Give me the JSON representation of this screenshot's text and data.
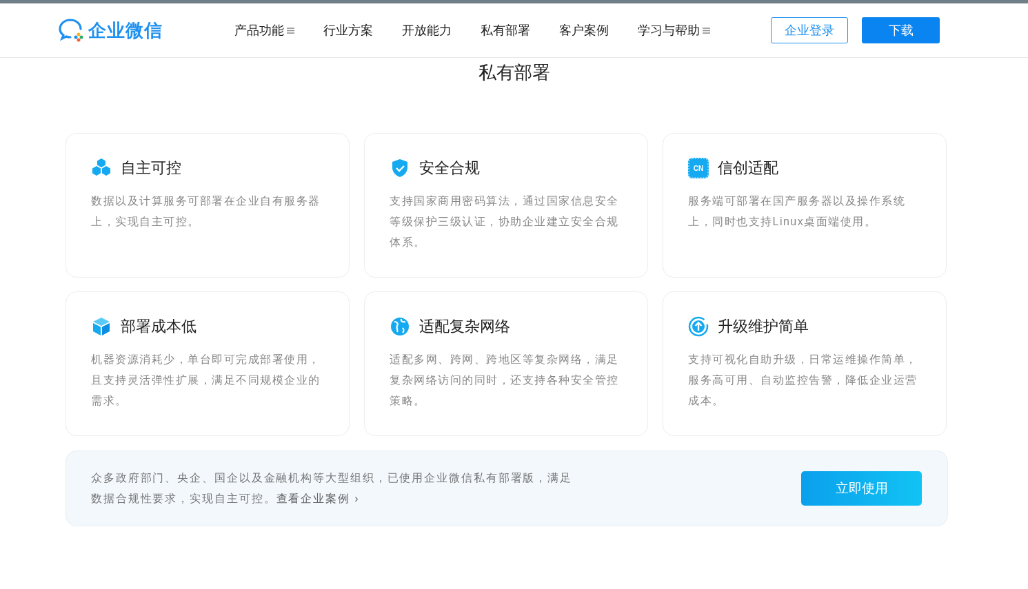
{
  "header": {
    "logo": "企业微信",
    "nav": [
      {
        "label": "产品功能",
        "has_menu": true
      },
      {
        "label": "行业方案",
        "has_menu": false
      },
      {
        "label": "开放能力",
        "has_menu": false
      },
      {
        "label": "私有部署",
        "has_menu": false
      },
      {
        "label": "客户案例",
        "has_menu": false
      },
      {
        "label": "学习与帮助",
        "has_menu": true
      }
    ],
    "login_button": "企业登录",
    "download_button": "下载"
  },
  "section_title": "私有部署",
  "cards": [
    {
      "kind": "hexagons",
      "title": "自主可控",
      "text": "数据以及计算服务可部署在企业自有服务器上，实现自主可控。"
    },
    {
      "kind": "shield",
      "title": "安全合规",
      "text": "支持国家商用密码算法，通过国家信息安全等级保护三级认证，协助企业建立安全合规体系。"
    },
    {
      "kind": "chip",
      "icon_text": "CN",
      "title": "信创适配",
      "text": "服务端可部署在国产服务器以及操作系统上，同时也支持Linux桌面端使用。"
    },
    {
      "kind": "cube",
      "title": "部署成本低",
      "text": "机器资源消耗少，单台即可完成部署使用，且支持灵活弹性扩展，满足不同规模企业的需求。"
    },
    {
      "kind": "globe",
      "title": "适配复杂网络",
      "text": "适配多网、跨网、跨地区等复杂网络，满足复杂网络访问的同时，还支持各种安全管控策略。"
    },
    {
      "kind": "upgrade",
      "title": "升级维护简单",
      "text": "支持可视化自助升级，日常运维操作简单，服务高可用、自动监控告警，降低企业运营成本。"
    }
  ],
  "banner": {
    "text": "众多政府部门、央企、国企以及金融机构等大型组织，已使用企业微信私有部署版，满足数据合规性要求，实现自主可控。",
    "link": "查看企业案例 ›",
    "button": "立即使用"
  }
}
